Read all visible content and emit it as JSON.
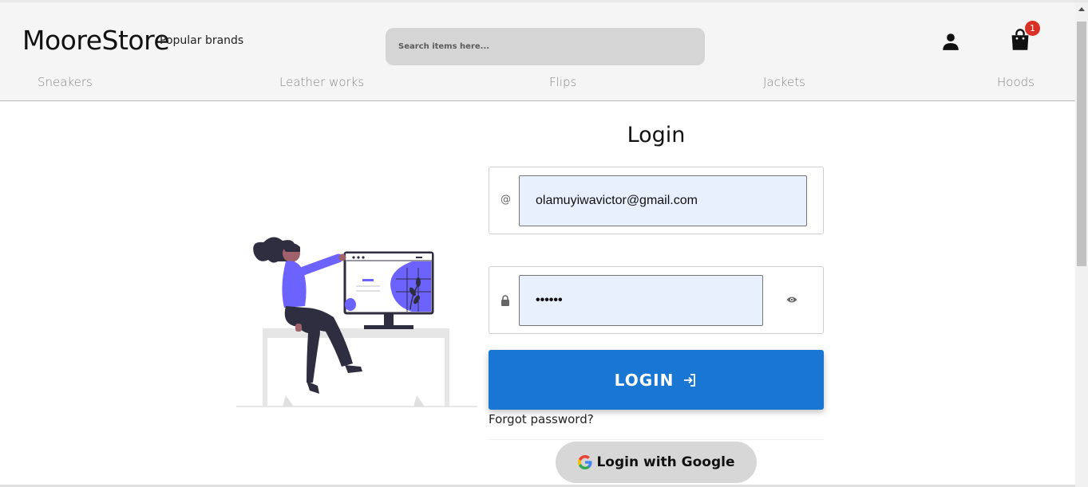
{
  "header": {
    "logo": "MooreStore",
    "popular_label": "Popular brands",
    "search_placeholder": "Search items here...",
    "cart_count": "1"
  },
  "nav": {
    "items": [
      "Sneakers",
      "Leather works",
      "Flips",
      "Jackets",
      "Hoods"
    ]
  },
  "login": {
    "title": "Login",
    "email_icon": "@",
    "email_value": "olamuyiwavictor@gmail.com",
    "password_value": "••••••",
    "button_label": "LOGIN",
    "forgot_label": "Forgot password?",
    "google_label": "Login with Google"
  },
  "colors": {
    "primary": "#1976d2",
    "badge": "#d93025",
    "input_fill": "#e8f0fe",
    "illustration_accent": "#6c63ff"
  },
  "icons": [
    "person-icon",
    "shopping-bag-icon",
    "at-icon",
    "lock-icon",
    "eye-icon",
    "login-arrow-icon",
    "google-icon"
  ]
}
